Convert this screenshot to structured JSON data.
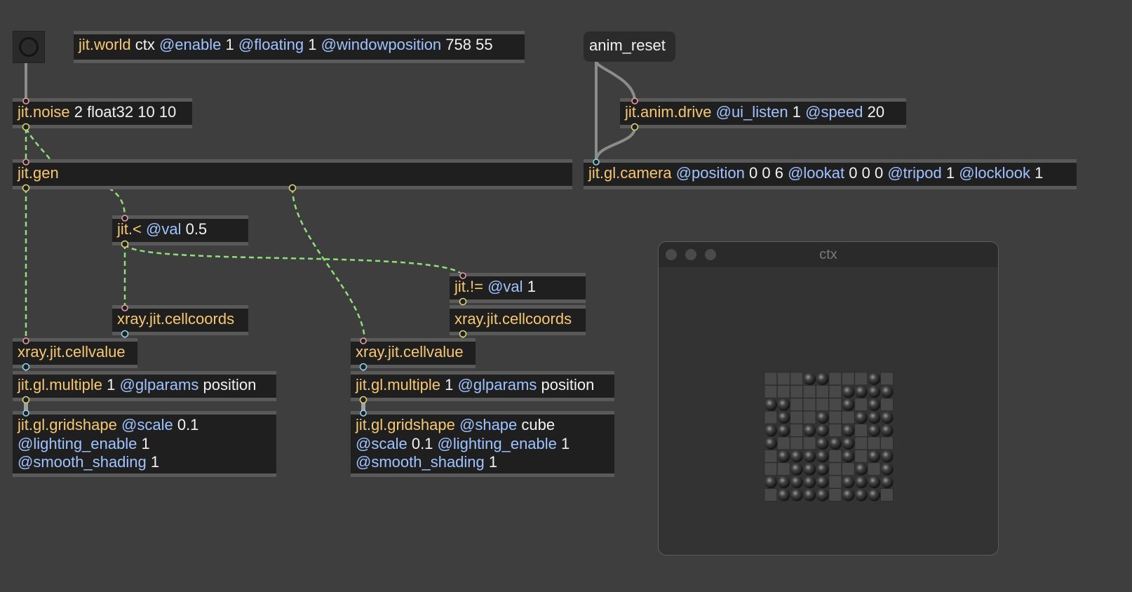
{
  "objects": {
    "world": {
      "cls": "jit.world",
      "a1": "ctx",
      "a2": "@enable",
      "a3": "1",
      "a4": "@floating",
      "a5": "1",
      "a6": "@windowposition",
      "a7": "758 55"
    },
    "noise": {
      "cls": "jit.noise",
      "args": "2 float32 10 10"
    },
    "gen": {
      "cls": "jit.gen"
    },
    "lt": {
      "cls": "jit.<",
      "attr": "@val",
      "val": "0.5"
    },
    "ne": {
      "cls": "jit.!=",
      "attr": "@val",
      "val": "1"
    },
    "cellcoords_left": {
      "cls": "xray.jit.cellcoords"
    },
    "cellcoords_right": {
      "cls": "xray.jit.cellcoords"
    },
    "cellvalue_left": {
      "cls": "xray.jit.cellvalue"
    },
    "cellvalue_right": {
      "cls": "xray.jit.cellvalue"
    },
    "multiple_left": {
      "cls": "jit.gl.multiple",
      "n": "1",
      "attr": "@glparams",
      "val": "position"
    },
    "multiple_right": {
      "cls": "jit.gl.multiple",
      "n": "1",
      "attr": "@glparams",
      "val": "position"
    },
    "gridshape_left": {
      "cls": "jit.gl.gridshape",
      "a1": "@scale",
      "v1": "0.1",
      "a2": "@lighting_enable",
      "v2": "1",
      "a3": "@smooth_shading",
      "v3": "1"
    },
    "gridshape_right": {
      "cls": "jit.gl.gridshape",
      "a1": "@shape",
      "v1": "cube",
      "a2": "@scale",
      "v2": "0.1",
      "a3": "@lighting_enable",
      "v3": "1",
      "a4": "@smooth_shading",
      "v4": "1"
    },
    "anim": {
      "cls": "jit.anim.drive",
      "a1": "@ui_listen",
      "v1": "1",
      "a2": "@speed",
      "v2": "20"
    },
    "camera": {
      "cls": "jit.gl.camera",
      "a1": "@position",
      "v1": "0 0 6",
      "a2": "@lookat",
      "v2": "0 0 0",
      "a3": "@tripod",
      "v3": "1",
      "a4": "@locklook",
      "v4": "1"
    }
  },
  "message": {
    "label": "anim_reset"
  },
  "window": {
    "title": "ctx"
  },
  "colors": {
    "background": "#3e3e3e",
    "object": "#1f1f1f",
    "class": "#f7c873",
    "attribute": "#9fc3ff",
    "wire_matrix": "#8ee07a"
  },
  "grid": {
    "rows": [
      "SSSBBSSSBS",
      "SSSSSSBBBB",
      "BBSSSSBSBS",
      "SBSSBSSBBB",
      "BBSBBSBSBB",
      "BSSSBBBSSS",
      "SBBBBSBSBB",
      "SSBBBSSBSB",
      "BBBBBSBBBB",
      "SBBBBSBBBS"
    ]
  }
}
